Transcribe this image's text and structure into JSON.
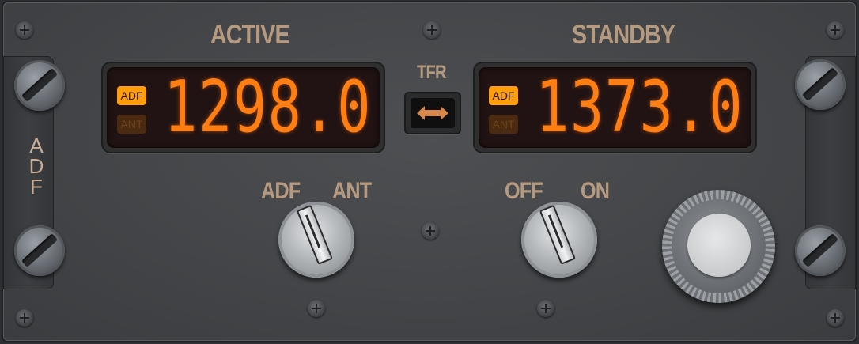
{
  "panel": {
    "side_label": [
      "A",
      "D",
      "F"
    ],
    "active_label": "ACTIVE",
    "standby_label": "STANDBY",
    "tfr_label": "TFR",
    "active": {
      "mode_on": "ADF",
      "mode_off": "ANT",
      "frequency": "1298.0"
    },
    "standby": {
      "mode_on": "ADF",
      "mode_off": "ANT",
      "frequency": "1373.0"
    },
    "mode_selector": {
      "left_label": "ADF",
      "right_label": "ANT"
    },
    "power_selector": {
      "left_label": "OFF",
      "right_label": "ON"
    }
  },
  "icons": {
    "tfr": "double-arrow-icon",
    "screws": "screw-icon"
  },
  "colors": {
    "display_digits": "#ff7e13",
    "annunciator_on": "#ff9d0d",
    "annunciator_off": "#4a2a10",
    "panel_label": "#b69a7f"
  }
}
